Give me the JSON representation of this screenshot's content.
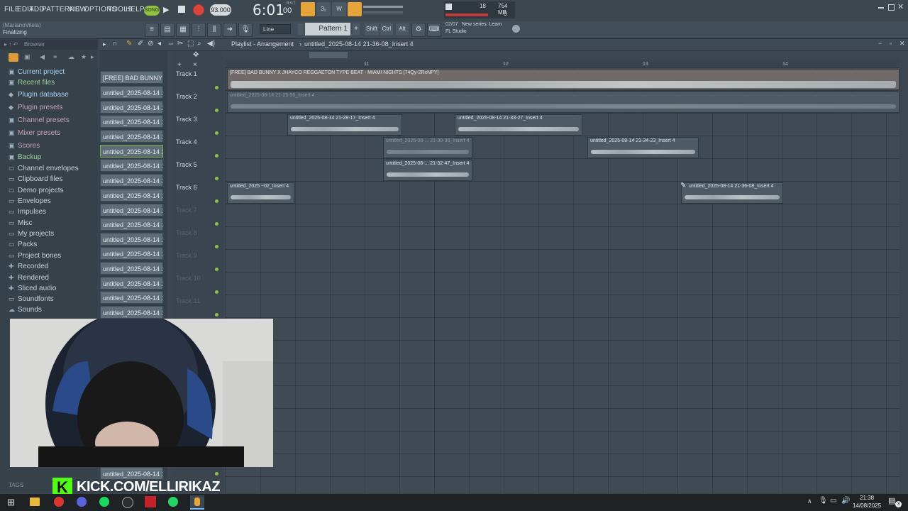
{
  "menu": [
    "FILE",
    "EDIT",
    "ADD",
    "PATTERNS",
    "VIEW",
    "OPTIONS",
    "TOOLS",
    "HELP"
  ],
  "transport": {
    "mode": "SONG",
    "tempo": "93.000",
    "time": "6:01",
    "time_sub": "00",
    "time_label": "B:S:T",
    "pattern": "Pattern 1"
  },
  "meters": {
    "cpu": "18",
    "mem": "754 MB",
    "voices": "0"
  },
  "hint": {
    "user": "(MarianoVilela)",
    "status": "Finalizing",
    "news_date": "02/07",
    "news_title": "New series: Learn",
    "news_sub": "FL Studio"
  },
  "toolbar2": {
    "snap": "Line",
    "shift": "Shift",
    "ctrl": "Ctrl",
    "alt": "Alt"
  },
  "browser": {
    "title": "Browser",
    "items": [
      {
        "label": "Current project",
        "icon": "folder-icon"
      },
      {
        "label": "Recent files",
        "icon": "folder-icon"
      },
      {
        "label": "Plugin database",
        "icon": "plug-icon"
      },
      {
        "label": "Plugin presets",
        "icon": "plug-icon"
      },
      {
        "label": "Channel presets",
        "icon": "folder-icon"
      },
      {
        "label": "Mixer presets",
        "icon": "folder-icon"
      },
      {
        "label": "Scores",
        "icon": "folder-icon"
      },
      {
        "label": "Backup",
        "icon": "folder-icon"
      },
      {
        "label": "Channel envelopes",
        "icon": "folder-icon"
      },
      {
        "label": "Clipboard files",
        "icon": "folder-icon"
      },
      {
        "label": "Demo projects",
        "icon": "folder-icon"
      },
      {
        "label": "Envelopes",
        "icon": "folder-icon"
      },
      {
        "label": "Impulses",
        "icon": "folder-icon"
      },
      {
        "label": "Misc",
        "icon": "folder-icon"
      },
      {
        "label": "My projects",
        "icon": "folder-icon"
      },
      {
        "label": "Packs",
        "icon": "folder-icon"
      },
      {
        "label": "Project bones",
        "icon": "folder-icon"
      },
      {
        "label": "Recorded",
        "icon": "plus-icon"
      },
      {
        "label": "Rendered",
        "icon": "plus-icon"
      },
      {
        "label": "Sliced audio",
        "icon": "plus-icon"
      },
      {
        "label": "Soundfonts",
        "icon": "folder-icon"
      },
      {
        "label": "Sounds",
        "icon": "cloud-icon"
      }
    ],
    "tags": "TAGS"
  },
  "playlist": {
    "title": "Playlist - Arrangement",
    "current": "untitled_2025-08-14 21-36-08_Insert 4",
    "patterns": [
      "[FREE] BAD BUNNY X...",
      "untitled_2025-08-14 21-...",
      "untitled_2025-08-14 21-...",
      "untitled_2025-08-14 21-...",
      "untitled_2025-08-14 21-...",
      "untitled_2025-08-14 21-...",
      "untitled_2025-08-14 21-...",
      "untitled_2025-08-14 21-...",
      "untitled_2025-08-14 21-...",
      "untitled_2025-08-14 21-...",
      "untitled_2025-08-14 21-...",
      "untitled_2025-08-14 21-...",
      "untitled_2025-08-14 21-...",
      "untitled_2025-08-14 21-...",
      "untitled_2025-08-14 21-...",
      "untitled_2025-08-14 21-...",
      "untitled_2025-08-14 21-..."
    ],
    "last_pattern": "untitled_2025-08-14 21-...",
    "tracks": [
      "Track 1",
      "Track 2",
      "Track 3",
      "Track 4",
      "Track 5",
      "Track 6",
      "Track 7",
      "Track 8",
      "Track 9",
      "Track 10",
      "Track 11"
    ],
    "ruler": [
      "11",
      "12",
      "13",
      "14"
    ],
    "clips": [
      {
        "label": "[FREE] BAD BUNNY X JHAYCO REGGAETON TYPE BEAT - MIAMI NIGHTS [74Qy-2RxNPY]"
      },
      {
        "label": "untitled_2025-08-14 21-25-56_Insert 4"
      },
      {
        "label": "untitled_2025-08-14 21-28-17_Insert 4"
      },
      {
        "label": "untitled_2025-08-14 21-33-27_Insert 4"
      },
      {
        "label": "untitled_2025-08-... 21-30-36_Insert 4"
      },
      {
        "label": "untitled_2025-08-14 21-34-23_Insert 4"
      },
      {
        "label": "untitled_2025-08-... 21-32-47_Insert 4"
      },
      {
        "label": "untitled_2025 ~02_Insert 4"
      },
      {
        "label": "untitled_2025-08-14 21-36-08_Insert 4"
      }
    ]
  },
  "overlay": {
    "kick": "KICK.COM/ELLIRIKAZ"
  },
  "taskbar": {
    "time": "21:38",
    "date": "14/08/2025",
    "notif": "3"
  }
}
